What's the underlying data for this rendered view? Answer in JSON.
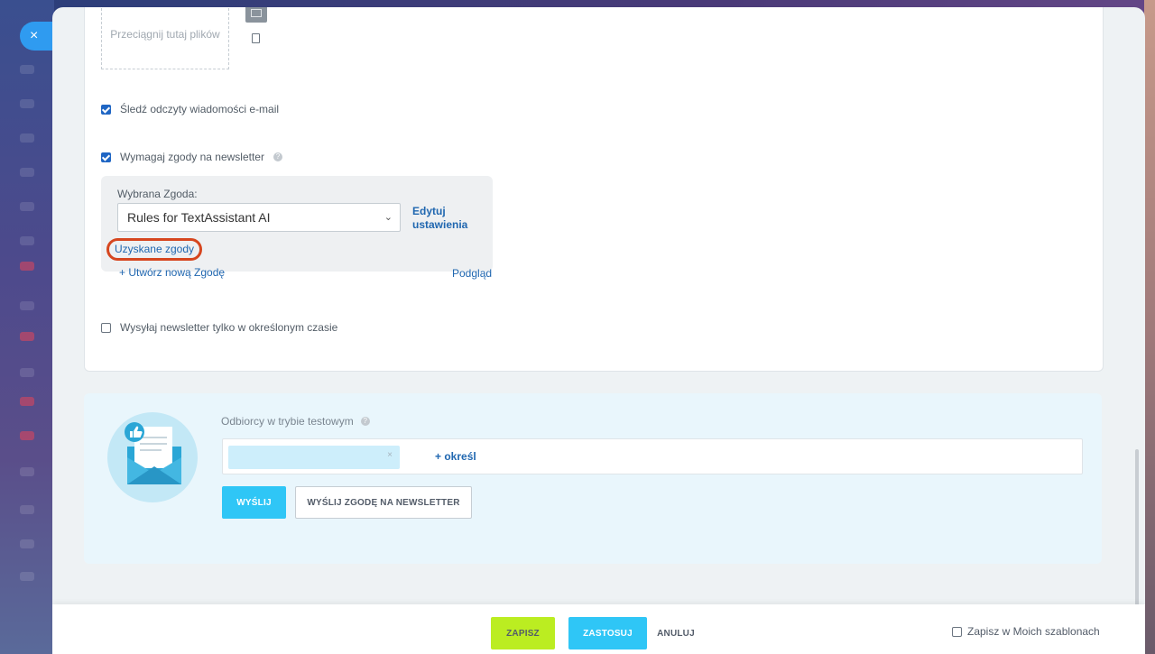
{
  "close_icon": "×",
  "upload": {
    "dropzone_text": "Przeciągnij tutaj plików"
  },
  "options": {
    "track_reads_label": "Śledź odczyty wiadomości e-mail",
    "track_reads_checked": true,
    "require_consent_label": "Wymagaj zgody na newsletter",
    "require_consent_checked": true,
    "send_time_label": "Wysyłaj newsletter tylko w określonym czasie",
    "send_time_checked": false
  },
  "consent": {
    "label": "Wybrana Zgoda:",
    "selected": "Rules for TextAssistant AI",
    "edit_link": "Edytuj ustawienia",
    "obtained_link": "Uzyskane zgody",
    "create_link": "+ Utwórz nową Zgodę",
    "preview_link": "Podgląd"
  },
  "test_mode": {
    "label": "Odbiorcy w trybie testowym",
    "tag_close": "×",
    "add_link": "+ określ",
    "send_button": "WYŚLIJ",
    "send_consent_button": "WYŚLIJ ZGODĘ NA NEWSLETTER"
  },
  "footer": {
    "save": "ZAPISZ",
    "apply": "ZASTOSUJ",
    "cancel": "ANULUJ",
    "save_template_label": "Zapisz w Moich szablonach",
    "save_template_checked": false
  },
  "colors": {
    "link": "#2067b0",
    "checkbox": "#1f66c4",
    "save_button": "#bbed21",
    "apply_button": "#2fc6f6",
    "highlight_outline": "#d6461f",
    "test_panel_bg": "#e9f6fc"
  },
  "icons": [
    "close-icon",
    "image-icon",
    "file-icon",
    "help-icon",
    "chevron-down-icon",
    "envelope-thumbs-up-illustration",
    "remove-icon"
  ]
}
